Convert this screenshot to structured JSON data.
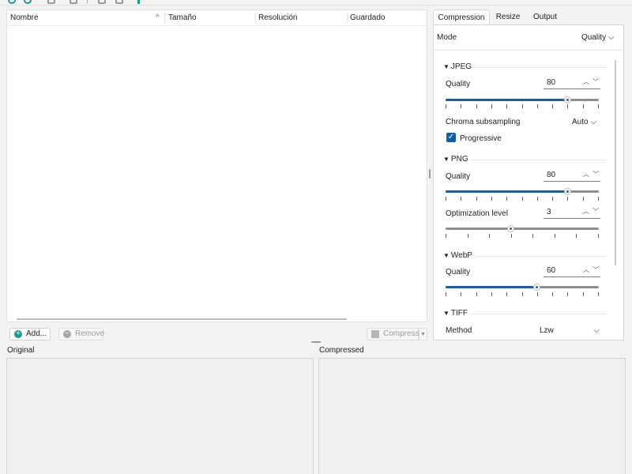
{
  "table": {
    "columns": [
      "Nombre",
      "Tamaño",
      "Resolución",
      "Guardado"
    ],
    "sort_indicator": "^",
    "rows": []
  },
  "actions": {
    "add_label": "Add...",
    "remove_label": "Remove",
    "compress_label": "Compress"
  },
  "preview": {
    "original_label": "Original",
    "compressed_label": "Compressed"
  },
  "tabs": [
    "Compression",
    "Resize",
    "Output"
  ],
  "active_tab": "Compression",
  "settings": {
    "mode_label": "Mode",
    "mode_value": "Quality",
    "jpeg": {
      "title": "JPEG",
      "quality_label": "Quality",
      "quality_value": "80",
      "quality_fraction": 0.8,
      "chroma_label": "Chroma subsampling",
      "chroma_value": "Auto",
      "progressive_label": "Progressive",
      "progressive_checked": true
    },
    "png": {
      "title": "PNG",
      "quality_label": "Quality",
      "quality_value": "80",
      "quality_fraction": 0.8,
      "optimization_label": "Optimization level",
      "optimization_value": "3",
      "optimization_fraction": 0.43
    },
    "webp": {
      "title": "WebP",
      "quality_label": "Quality",
      "quality_value": "60",
      "quality_fraction": 0.6
    },
    "tiff": {
      "title": "TIFF",
      "method_label": "Method",
      "method_value": "Lzw"
    }
  },
  "colors": {
    "accent": "#1a5ea8",
    "brand_teal": "#1a9b8c",
    "checkbox": "#0c5fa8"
  }
}
